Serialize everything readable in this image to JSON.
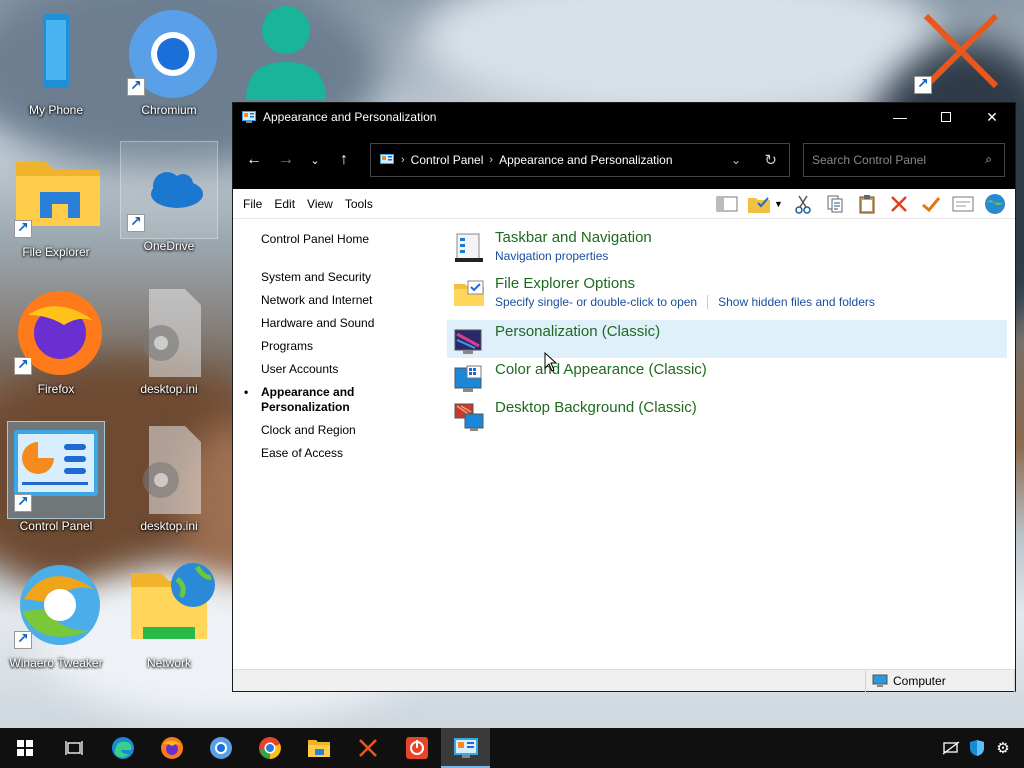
{
  "desktop": {
    "icons": [
      {
        "label": "My Phone"
      },
      {
        "label": "Chromium"
      },
      {
        "label": "File Explorer"
      },
      {
        "label": "OneDrive"
      },
      {
        "label": "Firefox"
      },
      {
        "label": "desktop.ini"
      },
      {
        "label": "Control Panel"
      },
      {
        "label": "desktop.ini"
      },
      {
        "label": "Winaero Tweaker"
      },
      {
        "label": "Network"
      }
    ]
  },
  "window": {
    "title": "Appearance and Personalization",
    "address": {
      "crumbs": [
        "Control Panel",
        "Appearance and Personalization"
      ]
    },
    "search": {
      "placeholder": "Search Control Panel"
    },
    "menu": [
      "File",
      "Edit",
      "View",
      "Tools"
    ],
    "leftnav": {
      "home": "Control Panel Home",
      "items": [
        "System and Security",
        "Network and Internet",
        "Hardware and Sound",
        "Programs",
        "User Accounts",
        "Appearance and Personalization",
        "Clock and Region",
        "Ease of Access"
      ]
    },
    "tasks": [
      {
        "title": "Taskbar and Navigation",
        "links": [
          "Navigation properties"
        ]
      },
      {
        "title": "File Explorer Options",
        "links": [
          "Specify single- or double-click to open",
          "Show hidden files and folders"
        ]
      },
      {
        "title": "Personalization (Classic)",
        "links": []
      },
      {
        "title": "Color and Appearance (Classic)",
        "links": []
      },
      {
        "title": "Desktop Background (Classic)",
        "links": []
      }
    ],
    "status": {
      "location": "Computer"
    }
  },
  "colors": {
    "task_title": "#1e6a1e",
    "task_link": "#1a4fa0",
    "hover_row": "#dff0fb",
    "taskbar_accent": "#79b8ec"
  }
}
